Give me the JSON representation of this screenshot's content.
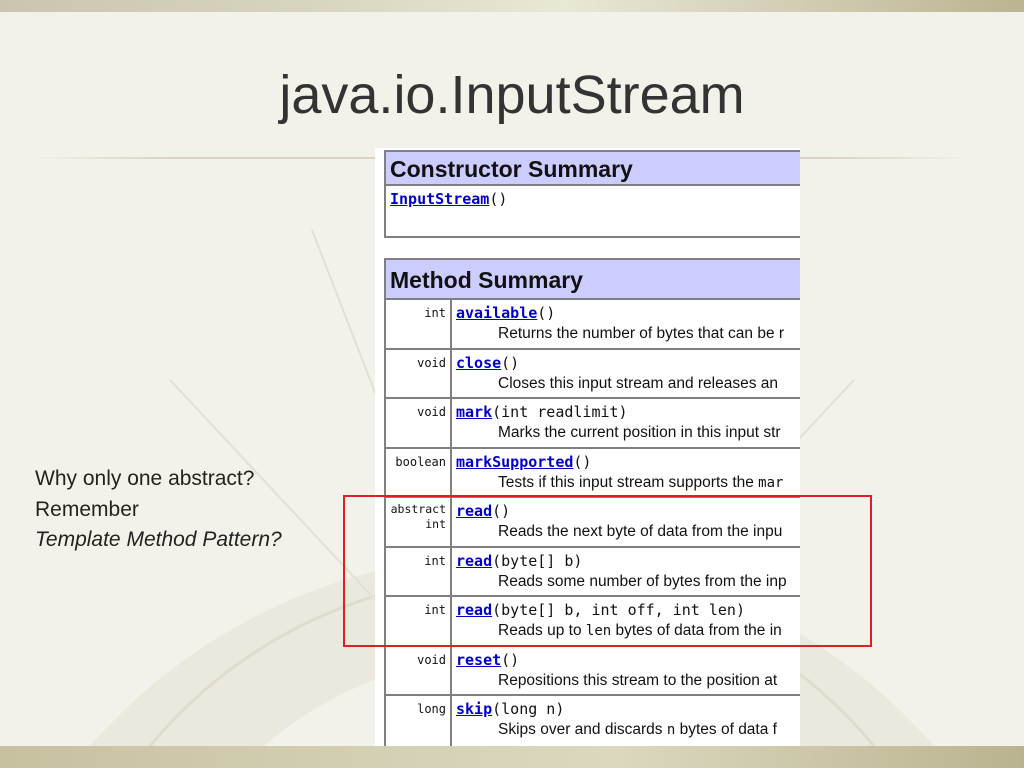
{
  "slide": {
    "title": "java.io.InputStream",
    "notes": {
      "line1": "Why only one abstract?",
      "line2": "Remember",
      "line3": "Template Method Pattern?"
    }
  },
  "constructor_summary": {
    "header": "Constructor Summary",
    "name": "InputStream",
    "params": "()"
  },
  "method_summary": {
    "header": "Method Summary",
    "rows": [
      {
        "type": "int",
        "name": "available",
        "params": "()",
        "desc": "Returns the number of bytes that can be r",
        "code": "",
        "desc_after": ""
      },
      {
        "type": "void",
        "name": "close",
        "params": "()",
        "desc": "Closes this input stream and releases an",
        "code": "",
        "desc_after": ""
      },
      {
        "type": "void",
        "name": "mark",
        "params": "(int readlimit)",
        "desc": "Marks the current position in this input str",
        "code": "",
        "desc_after": ""
      },
      {
        "type": "boolean",
        "name": "markSupported",
        "params": "()",
        "desc": "Tests if this input stream supports the ",
        "code": "mar",
        "desc_after": ""
      },
      {
        "type": "abstract int",
        "name": "read",
        "params": "()",
        "desc": "Reads the next byte of data from the inpu",
        "code": "",
        "desc_after": ""
      },
      {
        "type": "int",
        "name": "read",
        "params": "(byte[] b)",
        "desc": "Reads some number of bytes from the inp",
        "code": "",
        "desc_after": ""
      },
      {
        "type": "int",
        "name": "read",
        "params": "(byte[] b, int off, int len)",
        "desc": "Reads up to ",
        "code": "len",
        "desc_after": " bytes of data from the in"
      },
      {
        "type": "void",
        "name": "reset",
        "params": "()",
        "desc": "Repositions this stream to the position at",
        "code": "",
        "desc_after": ""
      },
      {
        "type": "long",
        "name": "skip",
        "params": "(long n)",
        "desc": "Skips over and discards ",
        "code": "n",
        "desc_after": " bytes of data f"
      }
    ]
  },
  "colors": {
    "header_bg": "#ccccff",
    "link": "#0000cc",
    "highlight_border": "#e02020"
  }
}
